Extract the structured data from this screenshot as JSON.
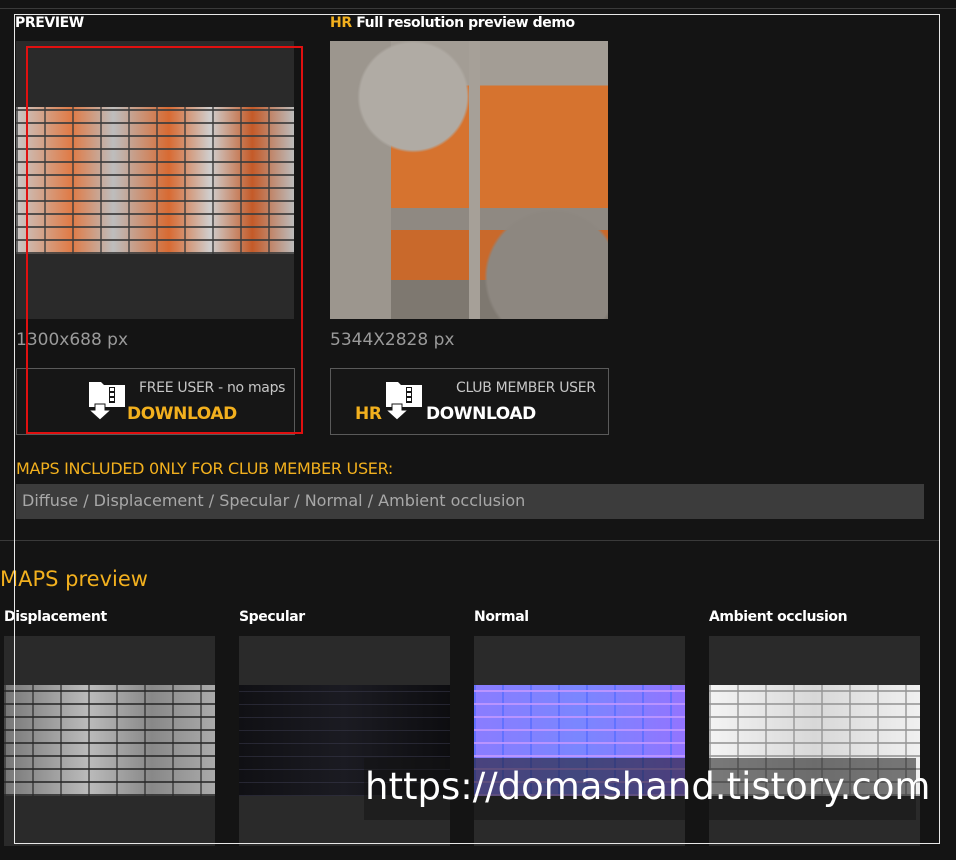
{
  "preview": {
    "title": "PREVIEW",
    "size": "1300x688 px"
  },
  "hr_preview": {
    "badge": "HR",
    "title": "Full resolution preview demo",
    "size": "5344X2828 px"
  },
  "free_download": {
    "caption": "FREE USER - no maps",
    "label": "DOWNLOAD"
  },
  "club_download": {
    "caption": "CLUB MEMBER USER",
    "badge": "HR",
    "label": "DOWNLOAD"
  },
  "maps_included": {
    "label": "MAPS INCLUDED 0NLY FOR CLUB MEMBER USER:",
    "list": "Diffuse / Displacement / Specular / Normal / Ambient occlusion"
  },
  "maps_preview": {
    "title": "MAPS preview",
    "items": [
      {
        "label": "Displacement"
      },
      {
        "label": "Specular"
      },
      {
        "label": "Normal"
      },
      {
        "label": "Ambient occlusion"
      }
    ]
  },
  "watermark": "https://domashand.tistory.com",
  "colors": {
    "accent": "#f2b01e",
    "highlight_box": "#e01010",
    "background": "#141414"
  },
  "icons": {
    "download": "folder-download-icon"
  }
}
